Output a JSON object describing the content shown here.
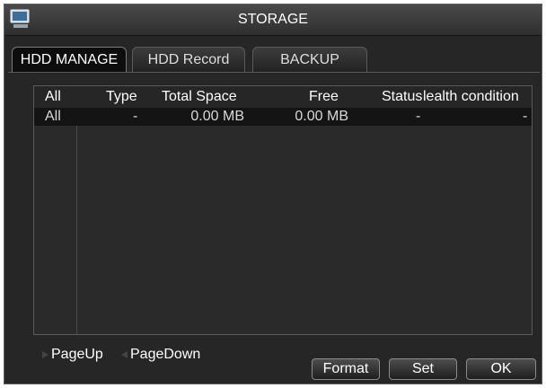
{
  "window": {
    "title": "STORAGE",
    "icon": "monitor-icon"
  },
  "tabs": [
    {
      "label": "HDD MANAGE",
      "active": true
    },
    {
      "label": "HDD Record",
      "active": false
    },
    {
      "label": "BACKUP",
      "active": false
    }
  ],
  "table": {
    "columns": [
      "All",
      "Type",
      "Total Space",
      "Free",
      "Status",
      "Health condition"
    ],
    "column_display": [
      "All",
      "Type",
      "Total Space",
      "Free",
      "Status",
      "lealth condition"
    ],
    "rows": [
      {
        "disk": "All",
        "type": "-",
        "total": "0.00 MB",
        "free": "0.00 MB",
        "status": "-",
        "health": "-"
      }
    ]
  },
  "pager": {
    "page_up": "PageUp",
    "page_down": "PageDown"
  },
  "buttons": {
    "format": "Format",
    "set": "Set",
    "ok": "OK"
  },
  "colors": {
    "background": "#262626",
    "selected_row": "#141414",
    "border": "#5a5a5a",
    "text": "#ffffff"
  }
}
